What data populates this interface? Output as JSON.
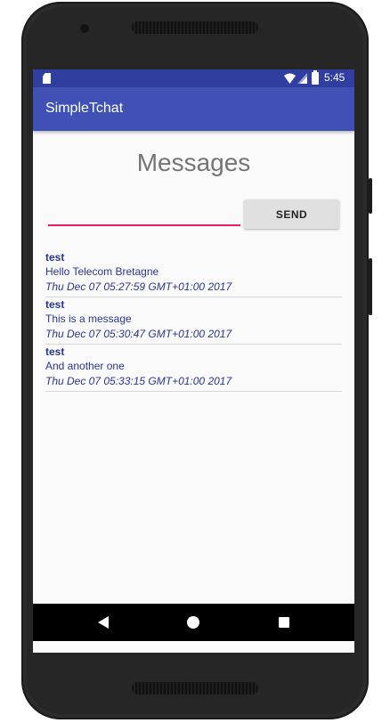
{
  "status_bar": {
    "time": "5:45"
  },
  "app_bar": {
    "title": "SimpleTchat"
  },
  "main": {
    "heading": "Messages",
    "message_input": {
      "value": "",
      "placeholder": ""
    },
    "send_label": "SEND"
  },
  "messages": [
    {
      "author": "test",
      "text": "Hello Telecom Bretagne",
      "date": "Thu Dec 07 05:27:59 GMT+01:00 2017"
    },
    {
      "author": "test",
      "text": "This is a message",
      "date": "Thu Dec 07 05:30:47 GMT+01:00 2017"
    },
    {
      "author": "test",
      "text": "And another one",
      "date": "Thu Dec 07 05:33:15 GMT+01:00 2017"
    }
  ],
  "colors": {
    "primary": "#3f51b5",
    "primary_dark": "#303f9f",
    "accent": "#e91e63",
    "message_text": "#283593"
  },
  "icons": [
    "sd-card-icon",
    "wifi-icon",
    "cell-signal-icon",
    "battery-icon",
    "back-icon",
    "home-icon",
    "recents-icon"
  ]
}
